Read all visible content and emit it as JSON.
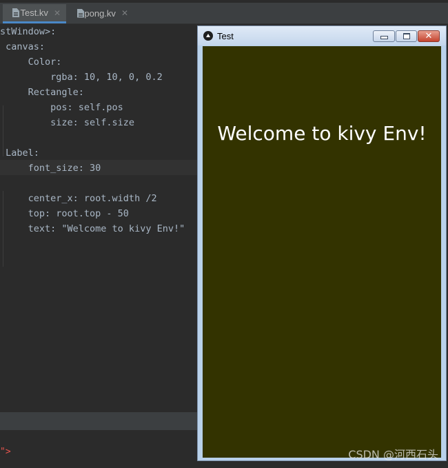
{
  "tabs": [
    {
      "label": "Test.kv",
      "close": "✕",
      "active": true
    },
    {
      "label": "pong.kv",
      "close": "✕",
      "active": false
    }
  ],
  "editor": {
    "lines": [
      "stWindow>:",
      " canvas:",
      "     Color:",
      "         rgba: 10, 10, 0, 0.2",
      "     Rectangle:",
      "         pos: self.pos",
      "         size: self.size",
      "",
      " Label:",
      "     font_size: 30",
      "",
      "     center_x: root.width /2",
      "     top: root.top - 50",
      "     text: \"Welcome to kivy Env!\""
    ],
    "tail": "\">"
  },
  "window": {
    "title": "Test",
    "label_text": "Welcome to kivy Env!",
    "background": "#333300"
  },
  "watermark": "CSDN @河西石头"
}
